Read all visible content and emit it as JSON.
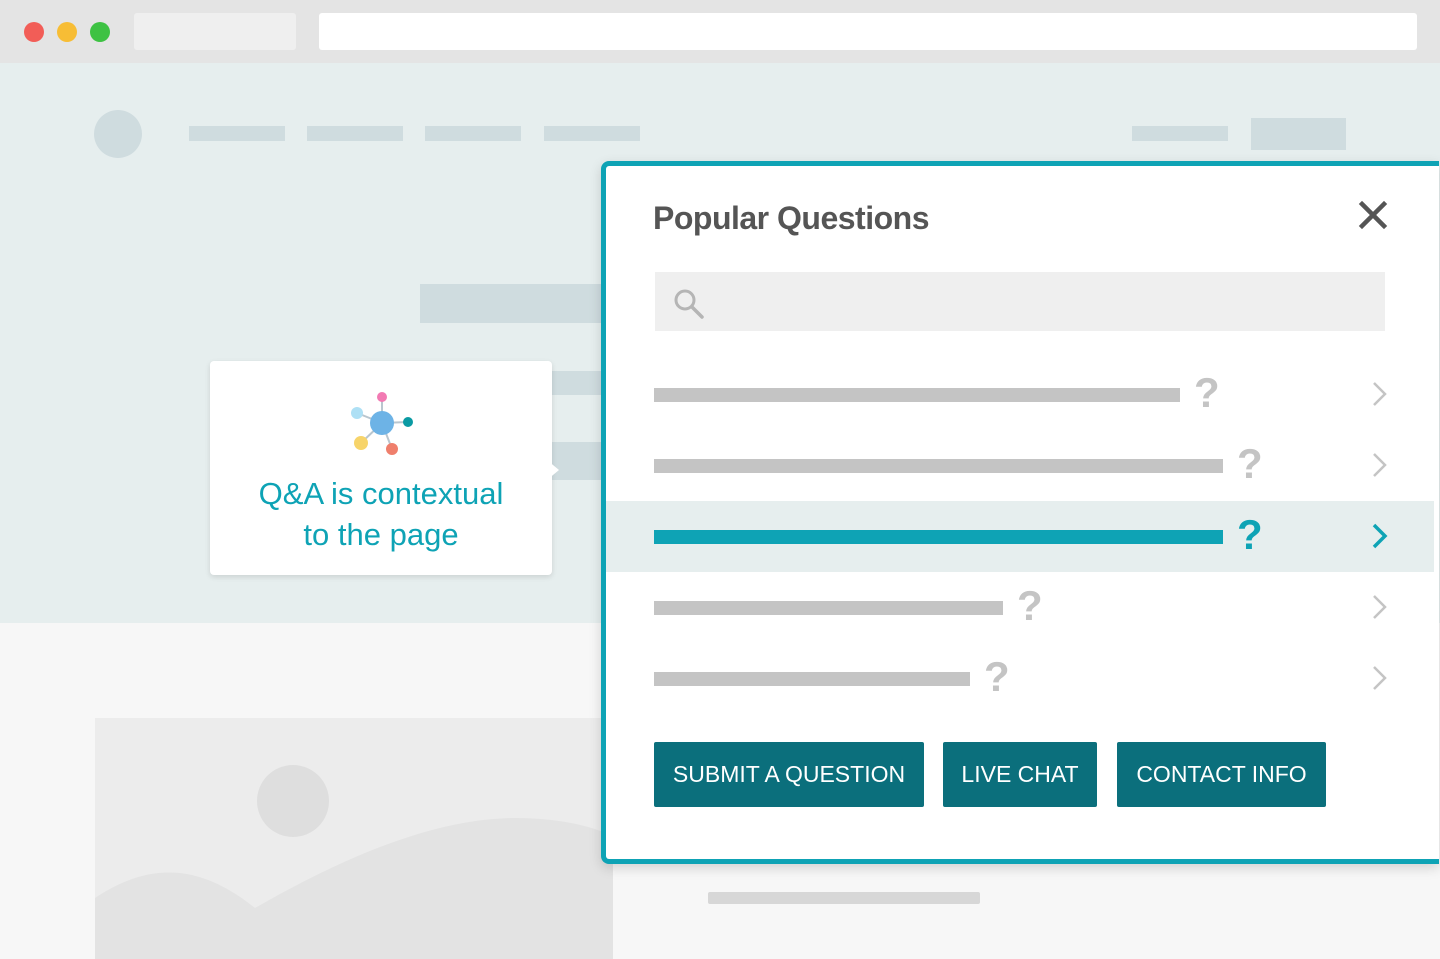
{
  "callout": {
    "line1": "Q&A is contextual",
    "line2": "to the page",
    "icon": "network-nodes-icon"
  },
  "modal": {
    "title": "Popular Questions",
    "close_icon": "close-icon",
    "search_icon": "search-icon",
    "search_placeholder": "",
    "questions": [
      {
        "mark": "?",
        "active": false
      },
      {
        "mark": "?",
        "active": false
      },
      {
        "mark": "?",
        "active": true
      },
      {
        "mark": "?",
        "active": false
      },
      {
        "mark": "?",
        "active": false
      }
    ],
    "buttons": {
      "submit": "SUBMIT A QUESTION",
      "chat": "LIVE CHAT",
      "contact": "CONTACT INFO"
    }
  },
  "colors": {
    "accent": "#0ea3b5",
    "button": "#0b6f7c",
    "hero_bg": "#e6eeee",
    "placeholder": "#cfdcdf"
  }
}
